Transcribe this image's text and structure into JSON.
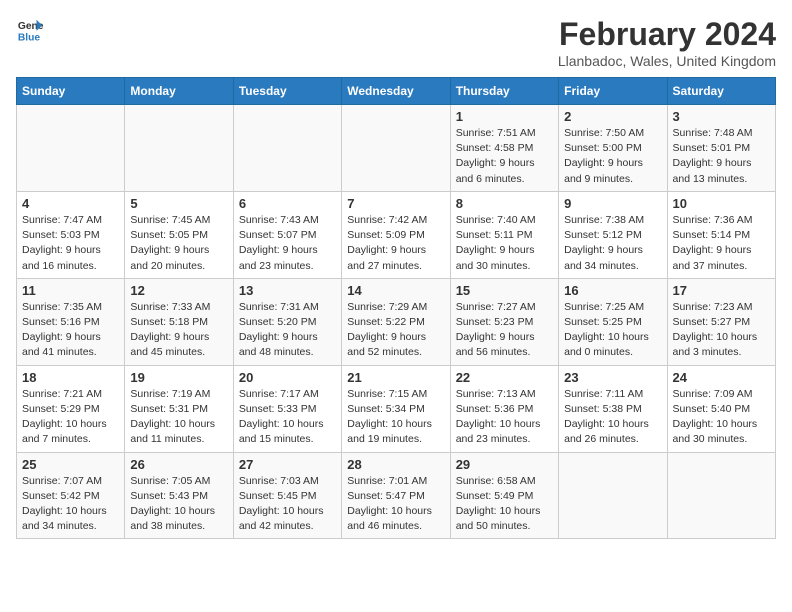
{
  "header": {
    "logo_line1": "General",
    "logo_line2": "Blue",
    "month": "February 2024",
    "location": "Llanbadoc, Wales, United Kingdom"
  },
  "weekdays": [
    "Sunday",
    "Monday",
    "Tuesday",
    "Wednesday",
    "Thursday",
    "Friday",
    "Saturday"
  ],
  "weeks": [
    [
      {
        "day": "",
        "info": ""
      },
      {
        "day": "",
        "info": ""
      },
      {
        "day": "",
        "info": ""
      },
      {
        "day": "",
        "info": ""
      },
      {
        "day": "1",
        "info": "Sunrise: 7:51 AM\nSunset: 4:58 PM\nDaylight: 9 hours\nand 6 minutes."
      },
      {
        "day": "2",
        "info": "Sunrise: 7:50 AM\nSunset: 5:00 PM\nDaylight: 9 hours\nand 9 minutes."
      },
      {
        "day": "3",
        "info": "Sunrise: 7:48 AM\nSunset: 5:01 PM\nDaylight: 9 hours\nand 13 minutes."
      }
    ],
    [
      {
        "day": "4",
        "info": "Sunrise: 7:47 AM\nSunset: 5:03 PM\nDaylight: 9 hours\nand 16 minutes."
      },
      {
        "day": "5",
        "info": "Sunrise: 7:45 AM\nSunset: 5:05 PM\nDaylight: 9 hours\nand 20 minutes."
      },
      {
        "day": "6",
        "info": "Sunrise: 7:43 AM\nSunset: 5:07 PM\nDaylight: 9 hours\nand 23 minutes."
      },
      {
        "day": "7",
        "info": "Sunrise: 7:42 AM\nSunset: 5:09 PM\nDaylight: 9 hours\nand 27 minutes."
      },
      {
        "day": "8",
        "info": "Sunrise: 7:40 AM\nSunset: 5:11 PM\nDaylight: 9 hours\nand 30 minutes."
      },
      {
        "day": "9",
        "info": "Sunrise: 7:38 AM\nSunset: 5:12 PM\nDaylight: 9 hours\nand 34 minutes."
      },
      {
        "day": "10",
        "info": "Sunrise: 7:36 AM\nSunset: 5:14 PM\nDaylight: 9 hours\nand 37 minutes."
      }
    ],
    [
      {
        "day": "11",
        "info": "Sunrise: 7:35 AM\nSunset: 5:16 PM\nDaylight: 9 hours\nand 41 minutes."
      },
      {
        "day": "12",
        "info": "Sunrise: 7:33 AM\nSunset: 5:18 PM\nDaylight: 9 hours\nand 45 minutes."
      },
      {
        "day": "13",
        "info": "Sunrise: 7:31 AM\nSunset: 5:20 PM\nDaylight: 9 hours\nand 48 minutes."
      },
      {
        "day": "14",
        "info": "Sunrise: 7:29 AM\nSunset: 5:22 PM\nDaylight: 9 hours\nand 52 minutes."
      },
      {
        "day": "15",
        "info": "Sunrise: 7:27 AM\nSunset: 5:23 PM\nDaylight: 9 hours\nand 56 minutes."
      },
      {
        "day": "16",
        "info": "Sunrise: 7:25 AM\nSunset: 5:25 PM\nDaylight: 10 hours\nand 0 minutes."
      },
      {
        "day": "17",
        "info": "Sunrise: 7:23 AM\nSunset: 5:27 PM\nDaylight: 10 hours\nand 3 minutes."
      }
    ],
    [
      {
        "day": "18",
        "info": "Sunrise: 7:21 AM\nSunset: 5:29 PM\nDaylight: 10 hours\nand 7 minutes."
      },
      {
        "day": "19",
        "info": "Sunrise: 7:19 AM\nSunset: 5:31 PM\nDaylight: 10 hours\nand 11 minutes."
      },
      {
        "day": "20",
        "info": "Sunrise: 7:17 AM\nSunset: 5:33 PM\nDaylight: 10 hours\nand 15 minutes."
      },
      {
        "day": "21",
        "info": "Sunrise: 7:15 AM\nSunset: 5:34 PM\nDaylight: 10 hours\nand 19 minutes."
      },
      {
        "day": "22",
        "info": "Sunrise: 7:13 AM\nSunset: 5:36 PM\nDaylight: 10 hours\nand 23 minutes."
      },
      {
        "day": "23",
        "info": "Sunrise: 7:11 AM\nSunset: 5:38 PM\nDaylight: 10 hours\nand 26 minutes."
      },
      {
        "day": "24",
        "info": "Sunrise: 7:09 AM\nSunset: 5:40 PM\nDaylight: 10 hours\nand 30 minutes."
      }
    ],
    [
      {
        "day": "25",
        "info": "Sunrise: 7:07 AM\nSunset: 5:42 PM\nDaylight: 10 hours\nand 34 minutes."
      },
      {
        "day": "26",
        "info": "Sunrise: 7:05 AM\nSunset: 5:43 PM\nDaylight: 10 hours\nand 38 minutes."
      },
      {
        "day": "27",
        "info": "Sunrise: 7:03 AM\nSunset: 5:45 PM\nDaylight: 10 hours\nand 42 minutes."
      },
      {
        "day": "28",
        "info": "Sunrise: 7:01 AM\nSunset: 5:47 PM\nDaylight: 10 hours\nand 46 minutes."
      },
      {
        "day": "29",
        "info": "Sunrise: 6:58 AM\nSunset: 5:49 PM\nDaylight: 10 hours\nand 50 minutes."
      },
      {
        "day": "",
        "info": ""
      },
      {
        "day": "",
        "info": ""
      }
    ]
  ]
}
